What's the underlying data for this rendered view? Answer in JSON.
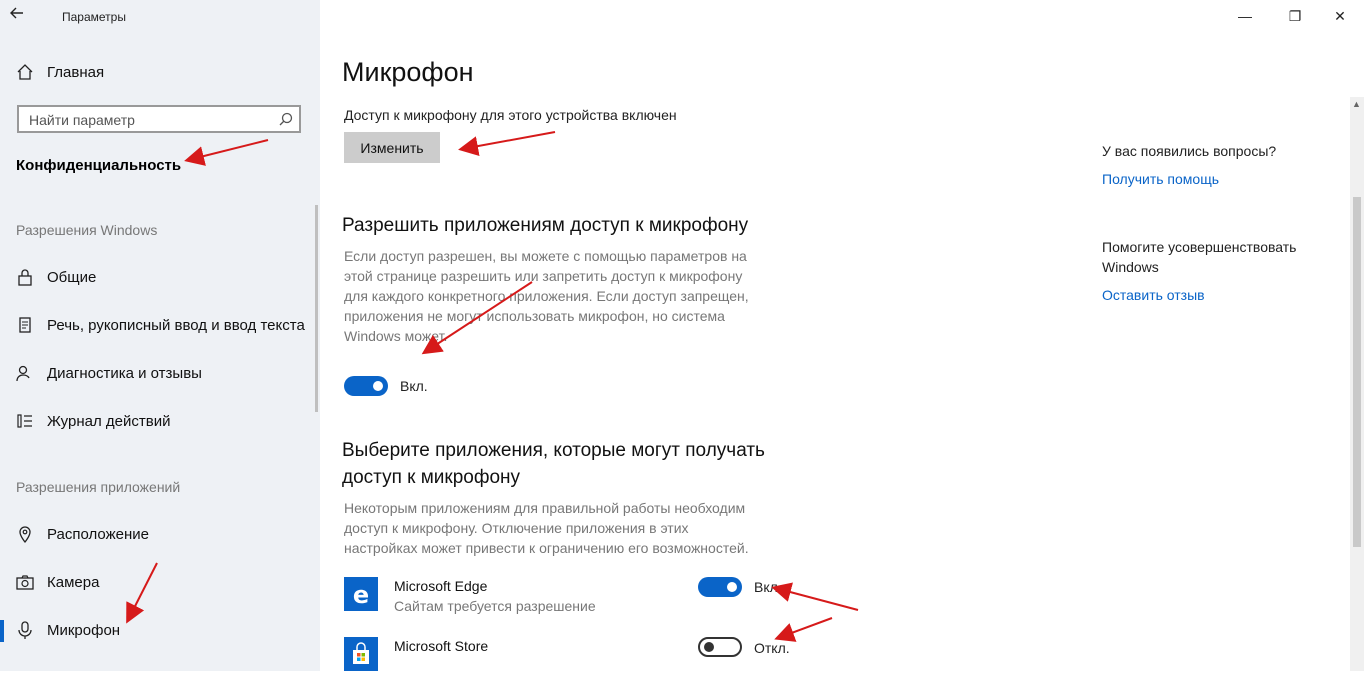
{
  "window": {
    "title": "Параметры",
    "minimize": "—",
    "maximize": "❐",
    "close": "✕"
  },
  "sidebar": {
    "home_label": "Главная",
    "search_placeholder": "Найти параметр",
    "section_title": "Конфиденциальность",
    "group_windows": "Разрешения Windows",
    "windows_items": [
      {
        "label": "Общие",
        "icon": "lock-icon"
      },
      {
        "label": "Речь, рукописный ввод и ввод текста",
        "icon": "document-icon"
      },
      {
        "label": "Диагностика и отзывы",
        "icon": "person-feedback-icon"
      },
      {
        "label": "Журнал действий",
        "icon": "history-icon"
      }
    ],
    "group_apps": "Разрешения приложений",
    "app_items": [
      {
        "label": "Расположение",
        "icon": "location-icon"
      },
      {
        "label": "Камера",
        "icon": "camera-icon"
      },
      {
        "label": "Микрофон",
        "icon": "microphone-icon",
        "selected": true
      }
    ]
  },
  "main": {
    "title": "Микрофон",
    "device_status": "Доступ к микрофону для этого устройства включен",
    "change_button": "Изменить",
    "allow_heading": "Разрешить приложениям доступ к микрофону",
    "allow_desc": [
      "Если доступ разрешен, вы можете с помощью параметров на",
      "этой странице разрешить или запретить доступ к микрофону",
      "для каждого конкретного приложения. Если доступ запрещен,",
      "приложения не могут использовать микрофон, но система",
      "Windows может."
    ],
    "allow_toggle_label": "Вкл.",
    "choose_heading_1": "Выберите приложения, которые могут получать",
    "choose_heading_2": "доступ к микрофону",
    "choose_desc": [
      "Некоторым приложениям для правильной работы необходим",
      "доступ к микрофону. Отключение приложения в этих",
      "настройках может привести к ограничению его возможностей."
    ],
    "apps": [
      {
        "name": "Microsoft Edge",
        "sub": "Сайтам требуется разрешение",
        "toggle_label": "Вкл.",
        "on": true
      },
      {
        "name": "Microsoft Store",
        "sub": "",
        "toggle_label": "Откл.",
        "on": false
      }
    ]
  },
  "aside": {
    "question": "У вас появились вопросы?",
    "help_link": "Получить помощь",
    "improve_1": "Помогите усовершенствовать",
    "improve_2": "Windows",
    "feedback_link": "Оставить отзыв"
  },
  "colors": {
    "accent": "#0a64c8",
    "sidebar_bg": "#eef1f5",
    "annotation_arrow": "#d61a1a"
  }
}
